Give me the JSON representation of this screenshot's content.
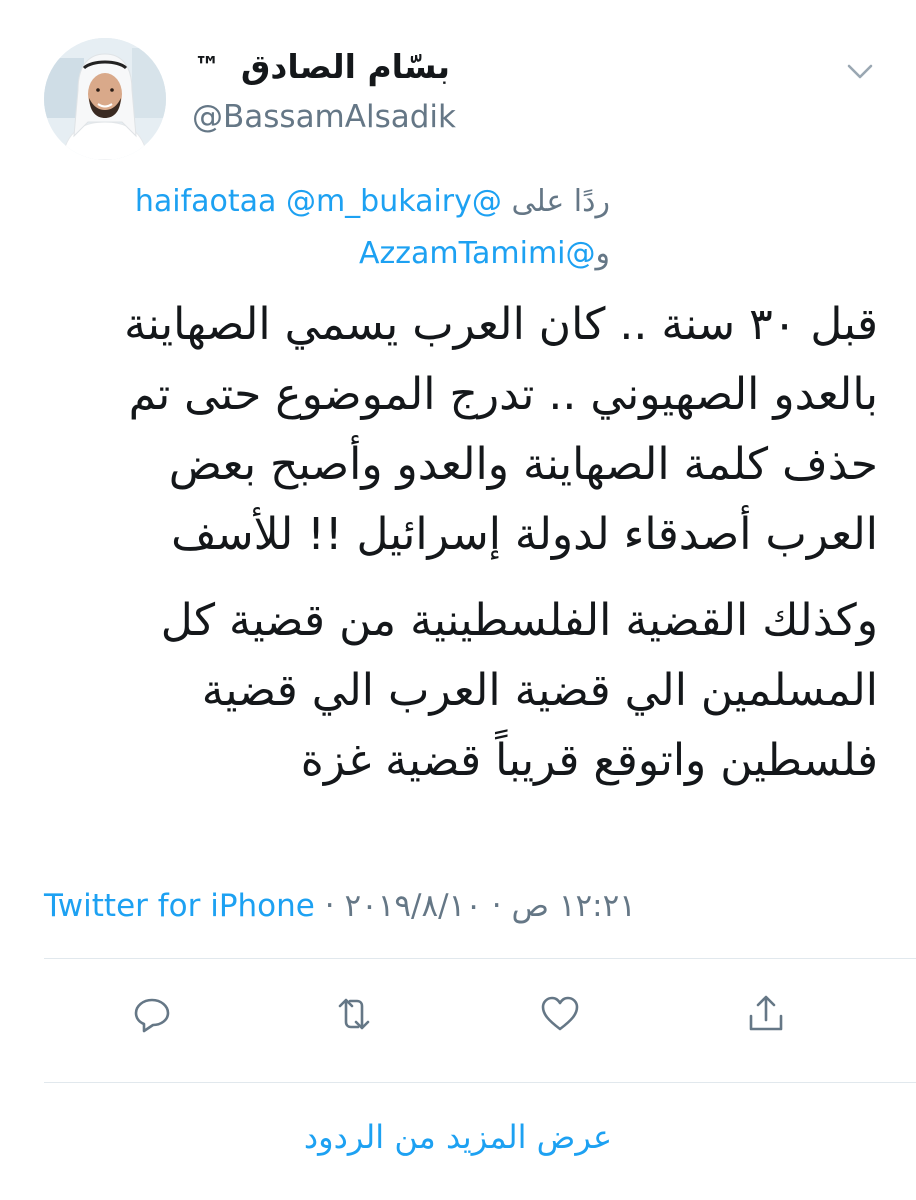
{
  "header": {
    "display_name": "بسّام الصادق",
    "trademark": "™",
    "handle": "@BassamAlsadik"
  },
  "reply": {
    "prefix": "ردًا على",
    "mention_1": "@haifaotaa",
    "mention_2": "@m_bukairy",
    "and_prefix": "و",
    "mention_3": "@AzzamTamimi"
  },
  "tweet": {
    "paragraph_1": [
      "قبل ٣٠ سنة .. كان العرب يسمي الصهاينة",
      "بالعدو الصهيوني .. تدرج الموضوع حتى تم",
      "حذف كلمة الصهاينة والعدو وأصبح بعض",
      "العرب أصدقاء لدولة إسرائيل !! للأسف"
    ],
    "paragraph_2": [
      "وكذلك القضية الفلسطينية من قضية كل",
      "المسلمين الي قضية العرب الي قضية",
      "فلسطين واتوقع قريباً قضية غزة"
    ]
  },
  "meta": {
    "time": "١٢:٢١ ص",
    "separator": "·",
    "date": "٢٠١٩/٨/١٠",
    "source": "Twitter for iPhone"
  },
  "actions": {
    "icons": [
      "reply-icon",
      "retweet-icon",
      "like-icon",
      "share-icon"
    ]
  },
  "footer": {
    "more_replies": "عرض المزيد من الردود"
  },
  "colors": {
    "link": "#1da1f2",
    "secondary_text": "#657786",
    "primary_text": "#14171a",
    "divider": "#e1e8ed"
  }
}
